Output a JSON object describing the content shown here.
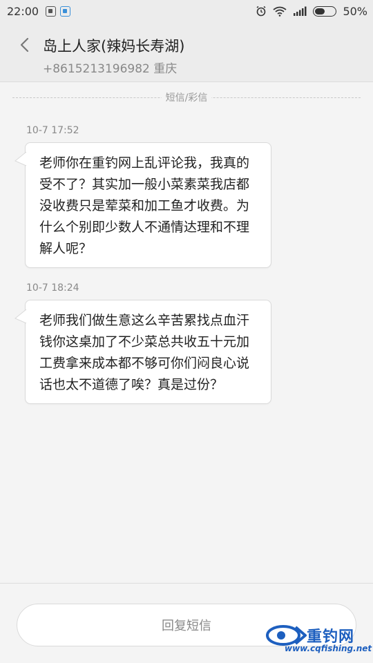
{
  "status_bar": {
    "time": "22:00",
    "battery": "50%",
    "battery_level": 0.5,
    "icons": [
      "sim-icon",
      "wifi-indicator-icon",
      "alarm-icon",
      "wifi-icon",
      "signal-icon",
      "battery-icon"
    ]
  },
  "header": {
    "title": "岛上人家(辣妈长寿湖)",
    "subtitle": "+8615213196982 重庆"
  },
  "thread": {
    "divider_label": "短信/彩信",
    "messages": [
      {
        "time": "10-7 17:52",
        "text": "老师你在重钓网上乱评论我，我真的受不了？其实加一般小菜素菜我店都没收费只是荤菜和加工鱼才收费。为什么个别即少数人不通情达理和不理解人呢？"
      },
      {
        "time": "10-7 18:24",
        "text": "老师我们做生意这么辛苦累找点血汗钱你这桌加了不少菜总共收五十元加工费拿来成本都不够可你们闷良心说话也太不道德了唉？真是过份？"
      }
    ]
  },
  "composer": {
    "placeholder": "回复短信"
  },
  "watermark": {
    "name": "重钓网",
    "url": "www.cqfishing.net",
    "color": "#1d5fbf"
  }
}
